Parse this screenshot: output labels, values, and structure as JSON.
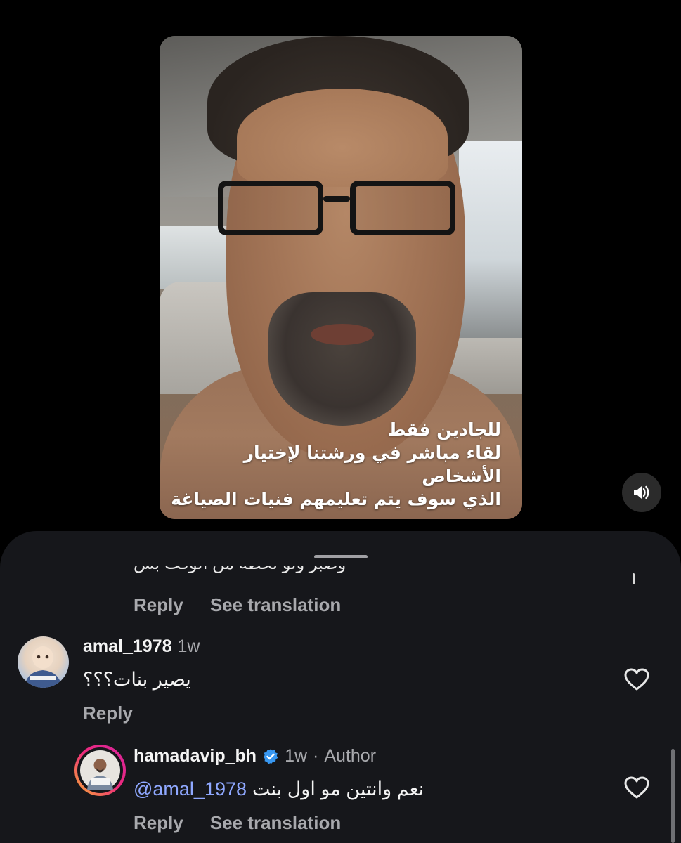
{
  "video": {
    "caption_lines": [
      "للجادين فقط",
      "لقاء مباشر في ورشتنا لإختيار الأشخاص",
      "الذي سوف يتم تعليمهم فنيات الصياغة"
    ],
    "sound_icon": "speaker-icon"
  },
  "comments": {
    "truncated_text": "وصبر ولو لحظة من الوقت بس",
    "actions_1": {
      "reply": "Reply",
      "translate": "See translation"
    },
    "items": [
      {
        "username": "amal_1978",
        "time": "1w",
        "text": "يصير بنات؟؟؟",
        "reply": "Reply"
      },
      {
        "username": "hamadavip_bh",
        "time": "1w",
        "separator": "·",
        "role": "Author",
        "mention": "@amal_1978",
        "text": "نعم وانتين مو اول بنت",
        "reply": "Reply",
        "translate": "See translation"
      }
    ]
  },
  "colors": {
    "background": "#000000",
    "sheet": "#16171b",
    "mention": "#8fa8ff",
    "verified": "#3897f0",
    "story_ring_start": "#f9b233",
    "story_ring_end": "#d6249f"
  }
}
